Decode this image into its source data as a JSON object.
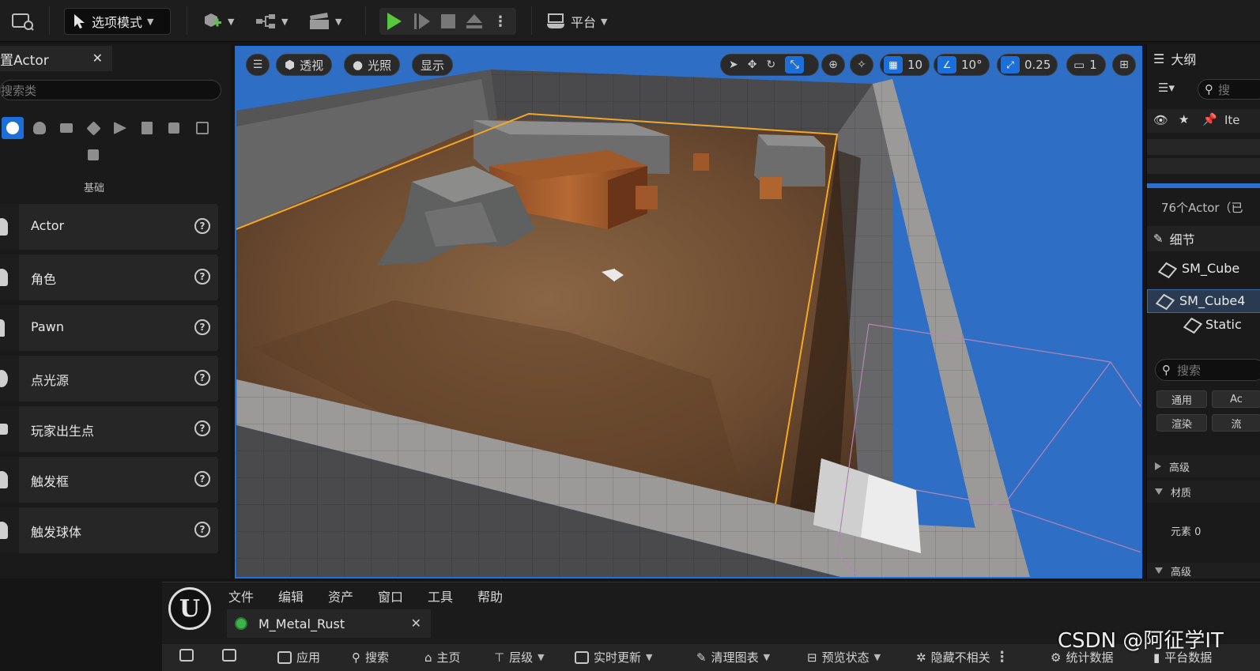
{
  "toolbar": {
    "mode_label": "选项模式",
    "platform_label": "平台"
  },
  "place_actors": {
    "tab_title": "置Actor",
    "search_placeholder": "搜索类",
    "category_label": "基础",
    "items": [
      {
        "label": "Actor"
      },
      {
        "label": "角色"
      },
      {
        "label": "Pawn"
      },
      {
        "label": "点光源"
      },
      {
        "label": "玩家出生点"
      },
      {
        "label": "触发框"
      },
      {
        "label": "触发球体"
      }
    ]
  },
  "viewport": {
    "perspective_label": "透视",
    "lighting_label": "光照",
    "show_label": "显示",
    "grid_snap_value": "10",
    "rotation_snap_value": "10°",
    "scale_snap_value": "0.25",
    "camera_speed_value": "1"
  },
  "outliner": {
    "title": "大纲",
    "search_placeholder": "搜",
    "column_label": "Ite",
    "actor_count": "76个Actor（已"
  },
  "details": {
    "title": "细节",
    "component_name": "SM_Cube",
    "selected_component": "SM_Cube4",
    "child_component": "Static",
    "search_placeholder": "搜索",
    "filter_general": "通用",
    "filter_actor": "Ac",
    "filter_render": "渲染",
    "filter_stream": "流",
    "section_advanced": "高级",
    "section_materials": "材质",
    "element_label": "元素 0",
    "section_advanced_2": "高级"
  },
  "material_editor": {
    "menu": [
      "文件",
      "编辑",
      "资产",
      "窗口",
      "工具",
      "帮助"
    ],
    "asset_tab": "M_Metal_Rust",
    "toolbar": {
      "apply": "应用",
      "search": "搜索",
      "home": "主页",
      "hierarchy": "层级",
      "live_update": "实时更新",
      "clean_graph": "清理图表",
      "preview_state": "预览状态",
      "hide_unrelated": "隐藏不相关",
      "stats": "统计数据",
      "platform_stats": "平台数据"
    }
  },
  "watermark": "CSDN @阿征学IT",
  "colors": {
    "accent": "#1c6fd8",
    "play_green": "#58c73e",
    "sky_blue": "#2f6ec5",
    "selection_orange": "#f5a623"
  }
}
